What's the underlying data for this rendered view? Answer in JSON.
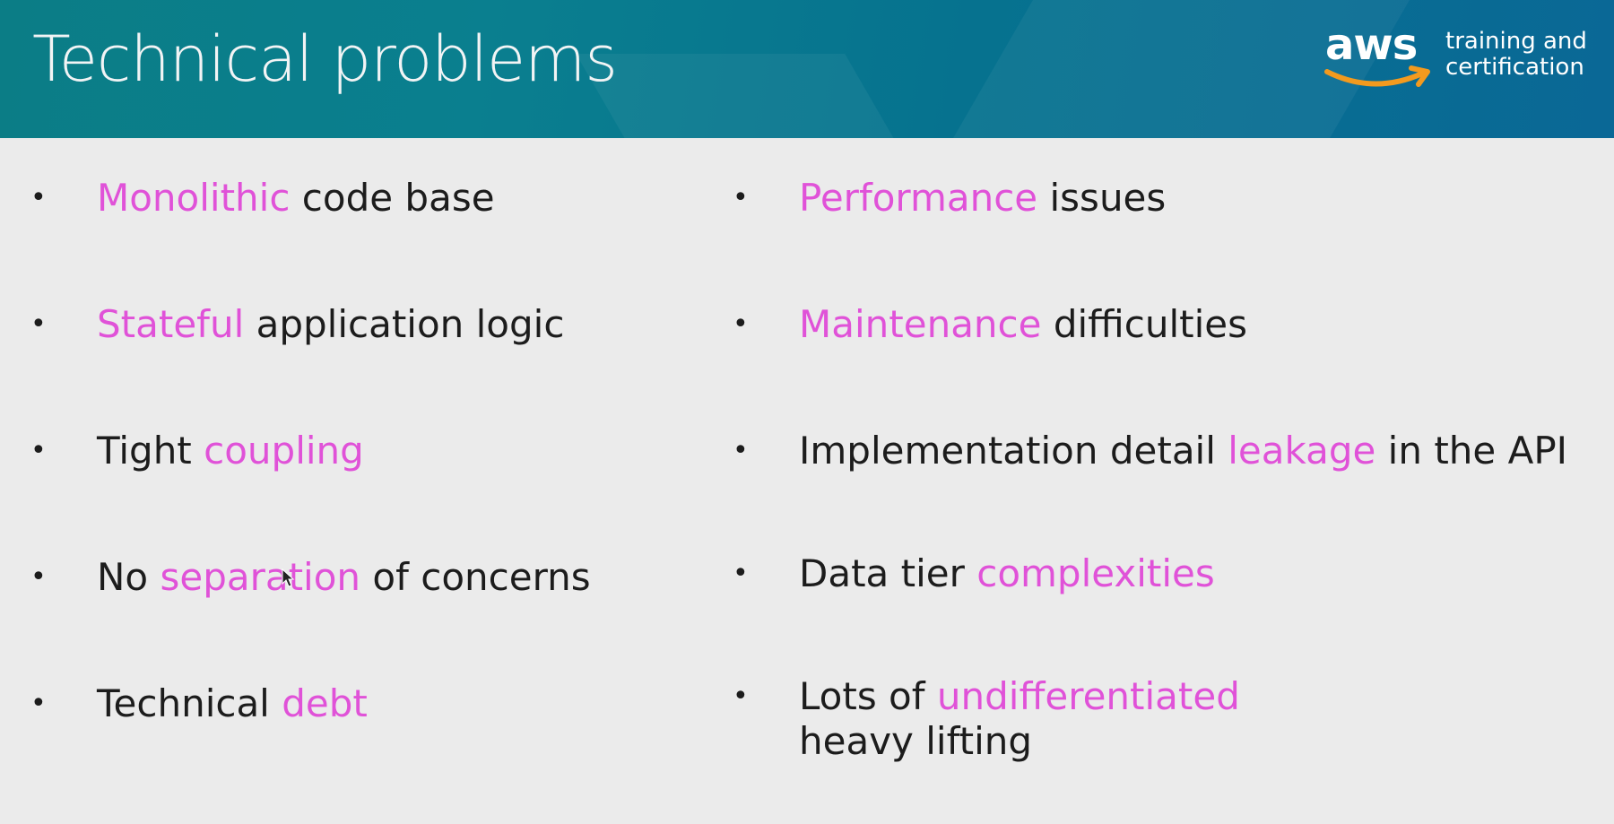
{
  "header": {
    "title": "Technical problems",
    "logo": {
      "wordmark": "aws",
      "tagline_line1": "training and",
      "tagline_line2": "certification"
    }
  },
  "colors": {
    "highlight": "#e052d8",
    "text": "#1c1c1c",
    "header_teal": "#0a7f8f",
    "smile_orange": "#f39a1e"
  },
  "left_column": [
    {
      "bullet": "•",
      "pre": "",
      "hl": "Monolithic",
      "post": " code base"
    },
    {
      "bullet": "•",
      "pre": "",
      "hl": "Stateful",
      "post": " application logic"
    },
    {
      "bullet": "•",
      "pre": "Tight ",
      "hl": "coupling",
      "post": ""
    },
    {
      "bullet": "•",
      "pre": "No ",
      "hl": "separation",
      "post": " of concerns"
    },
    {
      "bullet": "•",
      "pre": "Technical ",
      "hl": "debt",
      "post": ""
    }
  ],
  "right_column": [
    {
      "bullet": "•",
      "pre": "",
      "hl": "Performance",
      "post": " issues"
    },
    {
      "bullet": "•",
      "pre": "",
      "hl": "Maintenance",
      "post": " difficulties"
    },
    {
      "bullet": "•",
      "pre": "Implementation detail ",
      "hl": "leakage",
      "post": " in the API"
    },
    {
      "bullet": "•",
      "pre": "Data tier ",
      "hl": "complexities",
      "post": ""
    },
    {
      "bullet": "•",
      "pre": "Lots of ",
      "hl": "undifferentiated",
      "post": "",
      "line2": "heavy lifting"
    }
  ]
}
